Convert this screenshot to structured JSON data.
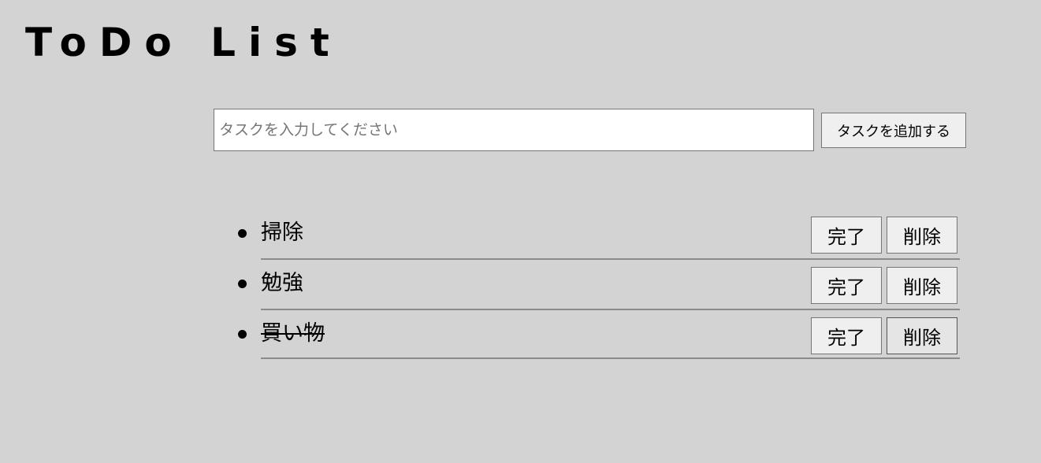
{
  "header": {
    "title": "ToDo List"
  },
  "form": {
    "input_placeholder": "タスクを入力してください",
    "input_value": "",
    "add_button_label": "タスクを追加する"
  },
  "tasks": [
    {
      "text": "掃除",
      "completed": false,
      "complete_label": "完了",
      "delete_label": "削除"
    },
    {
      "text": "勉強",
      "completed": false,
      "complete_label": "完了",
      "delete_label": "削除"
    },
    {
      "text": "買い物",
      "completed": true,
      "complete_label": "完了",
      "delete_label": "削除"
    }
  ],
  "colors": {
    "background": "#d3d3d3",
    "divider": "#8a8a8a",
    "button_bg": "#efefef"
  }
}
